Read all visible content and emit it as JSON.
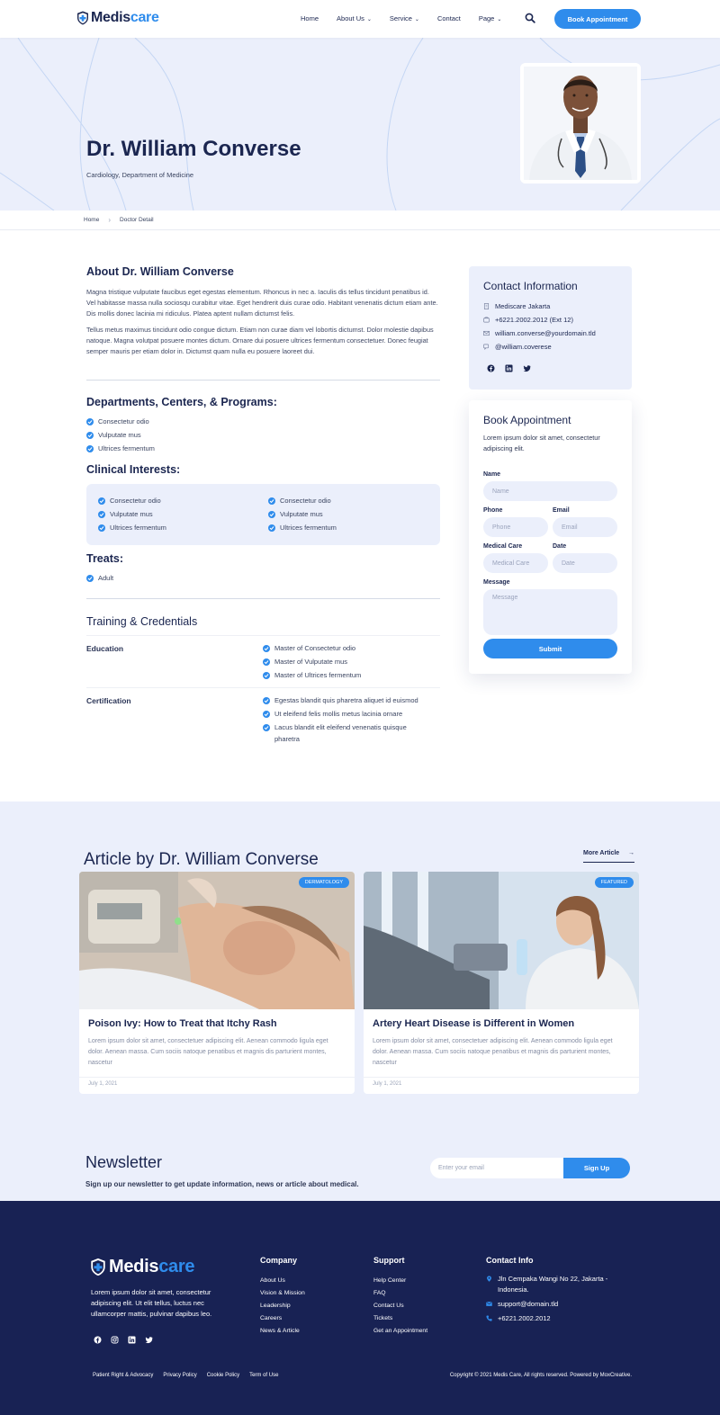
{
  "brand": {
    "part1": "Medis",
    "part2": "care"
  },
  "nav": {
    "items": [
      {
        "label": "Home",
        "has_caret": false
      },
      {
        "label": "About Us",
        "has_caret": true
      },
      {
        "label": "Service",
        "has_caret": true
      },
      {
        "label": "Contact",
        "has_caret": false
      },
      {
        "label": "Page",
        "has_caret": true
      }
    ],
    "book_label": "Book Appointment"
  },
  "hero": {
    "title": "Dr. William Converse",
    "subtitle": "Cardiology, Department of Medicine"
  },
  "breadcrumb": {
    "home": "Home",
    "current": "Doctor Detail"
  },
  "about": {
    "title": "About Dr. William Converse",
    "p1": "Magna tristique vulputate faucibus eget egestas elementum. Rhoncus in nec a. Iaculis dis tellus tincidunt penatibus id. Vel habitasse massa nulla sociosqu curabitur vitae. Eget hendrerit duis curae odio. Habitant venenatis dictum etiam ante. Dis mollis donec lacinia mi ridiculus. Platea aptent nullam dictumst felis.",
    "p2": "Tellus metus maximus tincidunt odio congue dictum. Etiam non curae diam vel lobortis dictumst. Dolor molestie dapibus natoque. Magna volutpat posuere montes dictum. Ornare dui posuere ultrices fermentum consectetuer. Donec feugiat semper mauris per etiam dolor in. Dictumst quam nulla eu posuere laoreet dui."
  },
  "departments": {
    "title": "Departments, Centers, & Programs:",
    "items": [
      "Consectetur odio",
      "Vulputate mus",
      "Ultrices fermentum"
    ]
  },
  "clinical": {
    "title": "Clinical Interests:",
    "col1": [
      "Consectetur odio",
      "Vulputate mus",
      "Ultrices fermentum"
    ],
    "col2": [
      "Consectetur odio",
      "Vulputate mus",
      "Ultrices fermentum"
    ]
  },
  "treats": {
    "title": "Treats:",
    "items": [
      "Adult"
    ]
  },
  "training": {
    "title": "Training & Credentials",
    "education_label": "Education",
    "education": [
      "Master of Consectetur odio",
      "Master of Vulputate mus",
      "Master of Ultrices fermentum"
    ],
    "certification_label": "Certification",
    "certification": [
      "Egestas blandit quis pharetra aliquet id euismod",
      "Ut eleifend felis mollis metus lacinia ornare",
      "Lacus blandit elit eleifend venenatis quisque",
      "pharetra"
    ]
  },
  "contact": {
    "title": "Contact Information",
    "location": "Mediscare Jakarta",
    "phone": "+6221.2002.2012 (Ext 12)",
    "email": "william.converse@yourdomain.tld",
    "handle": "@william.coverese"
  },
  "booking": {
    "title": "Book Appointment",
    "desc": "Lorem ipsum dolor sit amet, consectetur adipiscing elit.",
    "name_label": "Name",
    "name_ph": "Name",
    "phone_label": "Phone",
    "phone_ph": "Phone",
    "email_label": "Email",
    "email_ph": "Email",
    "care_label": "Medical Care",
    "care_ph": "Medical Care",
    "date_label": "Date",
    "date_ph": "Date",
    "message_label": "Message",
    "message_ph": "Message",
    "submit": "Submit"
  },
  "articles": {
    "title": "Article by Dr. William Converse",
    "more": "More Article",
    "cards": [
      {
        "tag": "DERMATOLOGY",
        "title": "Poison Ivy: How to Treat that Itchy Rash",
        "desc": "Lorem ipsum dolor sit amet, consectetuer adipiscing elit. Aenean commodo ligula eget dolor. Aenean massa. Cum sociis natoque penatibus et magnis dis parturient montes, nascetur",
        "date": "July 1, 2021"
      },
      {
        "tag": "FEATURED",
        "title": "Artery Heart Disease is Different in Women",
        "desc": "Lorem ipsum dolor sit amet, consectetuer adipiscing elit. Aenean commodo ligula eget dolor. Aenean massa. Cum sociis natoque penatibus et magnis dis parturient montes, nascetur",
        "date": "July 1, 2021"
      }
    ]
  },
  "newsletter": {
    "title": "Newsletter",
    "sub": "Sign up our newsletter to get update information, news or article about medical.",
    "placeholder": "Enter your email",
    "button": "Sign Up"
  },
  "footer": {
    "desc": "Lorem ipsum dolor sit amet, consectetur adipiscing elit. Ut elit tellus, luctus nec ullamcorper mattis, pulvinar dapibus leo.",
    "company_title": "Company",
    "company": [
      "About Us",
      "Vision & Mission",
      "Leadership",
      "Careers",
      "News & Article"
    ],
    "support_title": "Support",
    "support": [
      "Help Center",
      "FAQ",
      "Contact Us",
      "Tickets",
      "Get an Appointment"
    ],
    "contact_title": "Contact Info",
    "address": "Jln Cempaka Wangi No 22, Jakarta - Indonesia.",
    "email": "support@domain.tld",
    "phone": "+6221.2002.2012",
    "bottom_links": [
      "Patient Right & Advocacy",
      "Privacy Policy",
      "Cookie Policy",
      "Term of Use"
    ],
    "copyright": "Copyright © 2021 Medis Care, All rights reserved. Powered by MoxCreative."
  },
  "colors": {
    "accent": "#2f8cec",
    "navy": "#1b2650",
    "footer": "#182254",
    "light": "#ebeffb"
  }
}
